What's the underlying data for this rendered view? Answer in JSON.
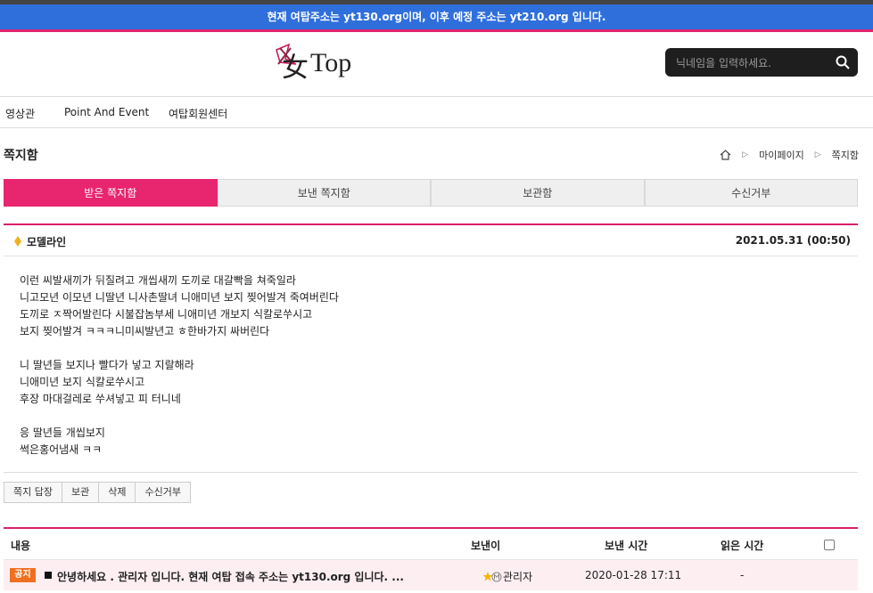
{
  "notice": "현재 여탑주소는 yt130.org이며, 이후 예정 주소는 yt210.org 입니다.",
  "logo_text": "女Top",
  "search": {
    "placeholder": "닉네임을 입력하세요."
  },
  "nav": [
    "영상관",
    "Point And Event",
    "여탑회원센터"
  ],
  "page_title": "쪽지함",
  "breadcrumb": [
    "마이페이지",
    "쪽지함"
  ],
  "tabs": [
    "받은 쪽지함",
    "보낸 쪽지함",
    "보관함",
    "수신거부"
  ],
  "message": {
    "sender": "모델라인",
    "date": "2021.05.31 (00:50)",
    "body": "이런 씨발새끼가 뒤질려고 개씹새끼 도끼로 대갈빡을 쳐죽일라\n니고모년 이모년 니딸년 니사촌딸녀 니애미년 보지 찢어발겨 죽여버린다\n도끼로 ㅈ짝어발린다 시불잡놈부세 니애미년 개보지 식칼로쑤시고\n보지 찢어발겨 ㅋㅋㅋ니미씨발년고 ㅎ한바가지 싸버린다\n\n니 딸년들 보지나 빨다가 넣고 지랄해라\n니애미년 보지 식칼로쑤시고\n후장 마대걸레로 쑤셔넣고 피 터니네\n\n응 딸년들 개씹보지\n썩은홍어냄새 ㅋㅋ"
  },
  "actions": [
    "쪽지 답장",
    "보관",
    "삭제",
    "수신거부"
  ],
  "list": {
    "headers": {
      "content": "내용",
      "from": "보낸이",
      "sent": "보낸 시간",
      "read": "읽은 시간"
    },
    "rows": [
      {
        "badge": "공지",
        "subject": "안녕하세요 . 관리자 입니다. 현재 여탑 접속 주소는 yt130.org 입니다. ...",
        "from": "관리자",
        "sent": "2020-01-28 17:11",
        "read": "-"
      }
    ]
  },
  "colors": {
    "accent": "#e8256f",
    "notice_bar": "#2f6fdc",
    "badge": "#f07020"
  }
}
